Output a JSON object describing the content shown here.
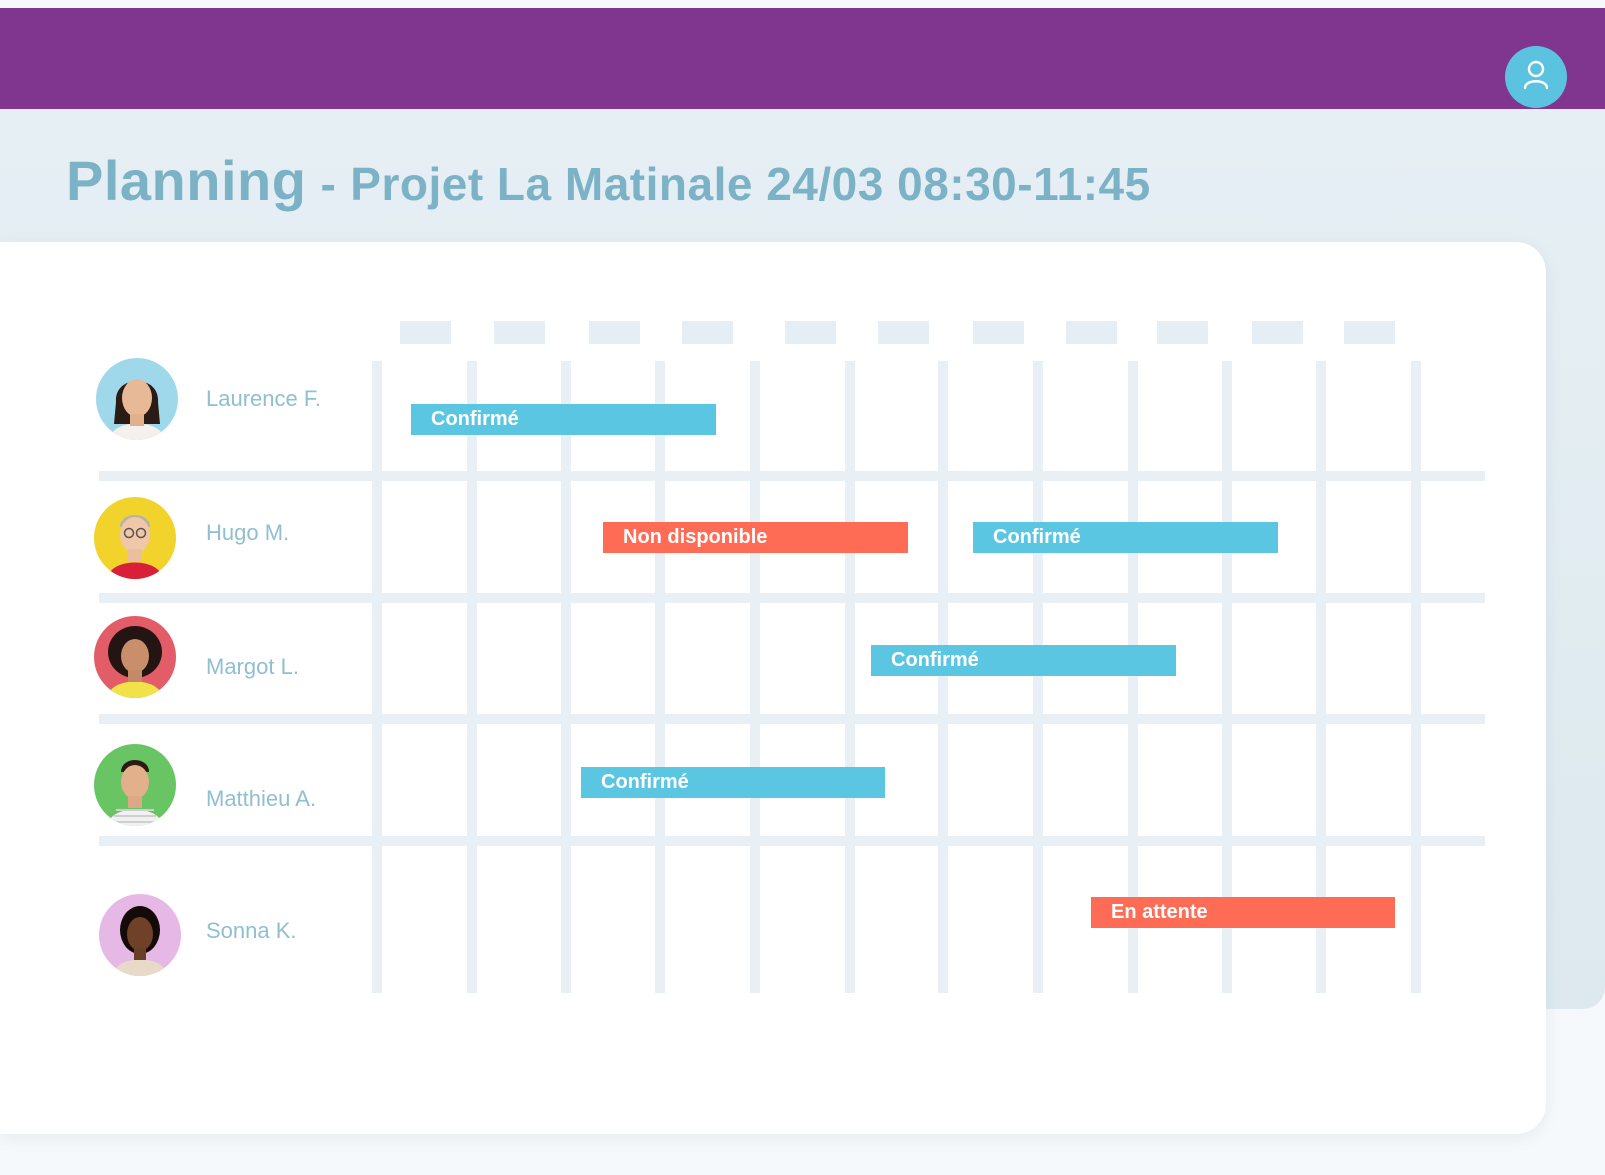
{
  "header": {
    "user_icon": "user-icon",
    "bar_color": "#80358f",
    "button_color": "#5bc3e0"
  },
  "page": {
    "title": "Planning",
    "separator": "-",
    "subtitle": "Projet La Matinale 24/03 08:30-11:45"
  },
  "schedule": {
    "rows": [
      {
        "name": "Laurence F.",
        "avatar_color": "#9fd8ea",
        "bookings": [
          {
            "status": "Confirmé",
            "color": "#5bc6e2"
          }
        ]
      },
      {
        "name": "Hugo M.",
        "avatar_color": "#f2d32c",
        "bookings": [
          {
            "status": "Non disponible",
            "color": "#ff6c55"
          },
          {
            "status": "Confirmé",
            "color": "#5bc6e2"
          }
        ]
      },
      {
        "name": "Margot L.",
        "avatar_color": "#e25d67",
        "bookings": [
          {
            "status": "Confirmé",
            "color": "#5bc6e2"
          }
        ]
      },
      {
        "name": "Matthieu A.",
        "avatar_color": "#69c463",
        "bookings": [
          {
            "status": "Confirmé",
            "color": "#5bc6e2"
          }
        ]
      },
      {
        "name": "Sonna K.",
        "avatar_color": "#e6b8e6",
        "bookings": [
          {
            "status": "En attente",
            "color": "#ff6c55"
          }
        ]
      }
    ]
  }
}
